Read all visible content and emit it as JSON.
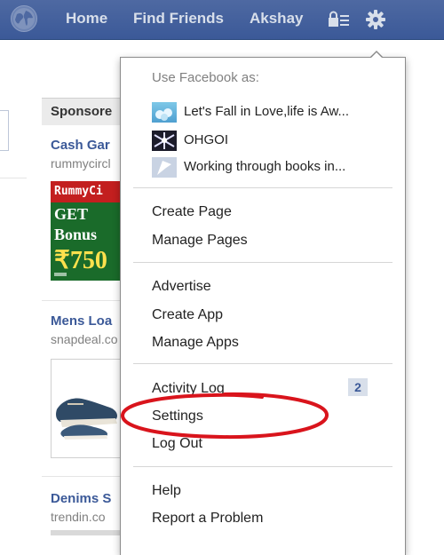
{
  "topbar": {
    "home_label": "Home",
    "find_friends_label": "Find Friends",
    "user_label": "Akshay",
    "privacy_icon": "lock-list-icon",
    "settings_icon": "gear-icon",
    "logo_icon": "globe-icon",
    "bar_color": "#3b5998"
  },
  "sidebar": {
    "sponsored_label": "Sponsore",
    "ads": [
      {
        "title": "Cash Gar",
        "url": "rummycircl"
      },
      {
        "title": "Mens Loa",
        "url": "snapdeal.co"
      },
      {
        "title": "Denims S",
        "url": "trendin.co"
      }
    ],
    "rummy_ad": {
      "banner": "RummyCi",
      "line1": "GET",
      "line2": "Bonus",
      "line3": "₹750"
    }
  },
  "menu": {
    "heading": "Use Facebook as:",
    "pages": [
      {
        "name": "Let's Fall in Love,life is Aw...",
        "thumb_icon": "page-thumbnail-icon"
      },
      {
        "name": "OHGOI",
        "thumb_icon": "page-thumbnail-icon"
      },
      {
        "name": "Working through books in...",
        "thumb_icon": "page-thumbnail-icon"
      }
    ],
    "create_page": "Create Page",
    "manage_pages": "Manage Pages",
    "advertise": "Advertise",
    "create_app": "Create App",
    "manage_apps": "Manage Apps",
    "activity_log": "Activity Log",
    "activity_count": "2",
    "settings": "Settings",
    "log_out": "Log Out",
    "help": "Help",
    "report_problem": "Report a Problem"
  },
  "annotation": {
    "highlight_color": "#d9141c"
  }
}
